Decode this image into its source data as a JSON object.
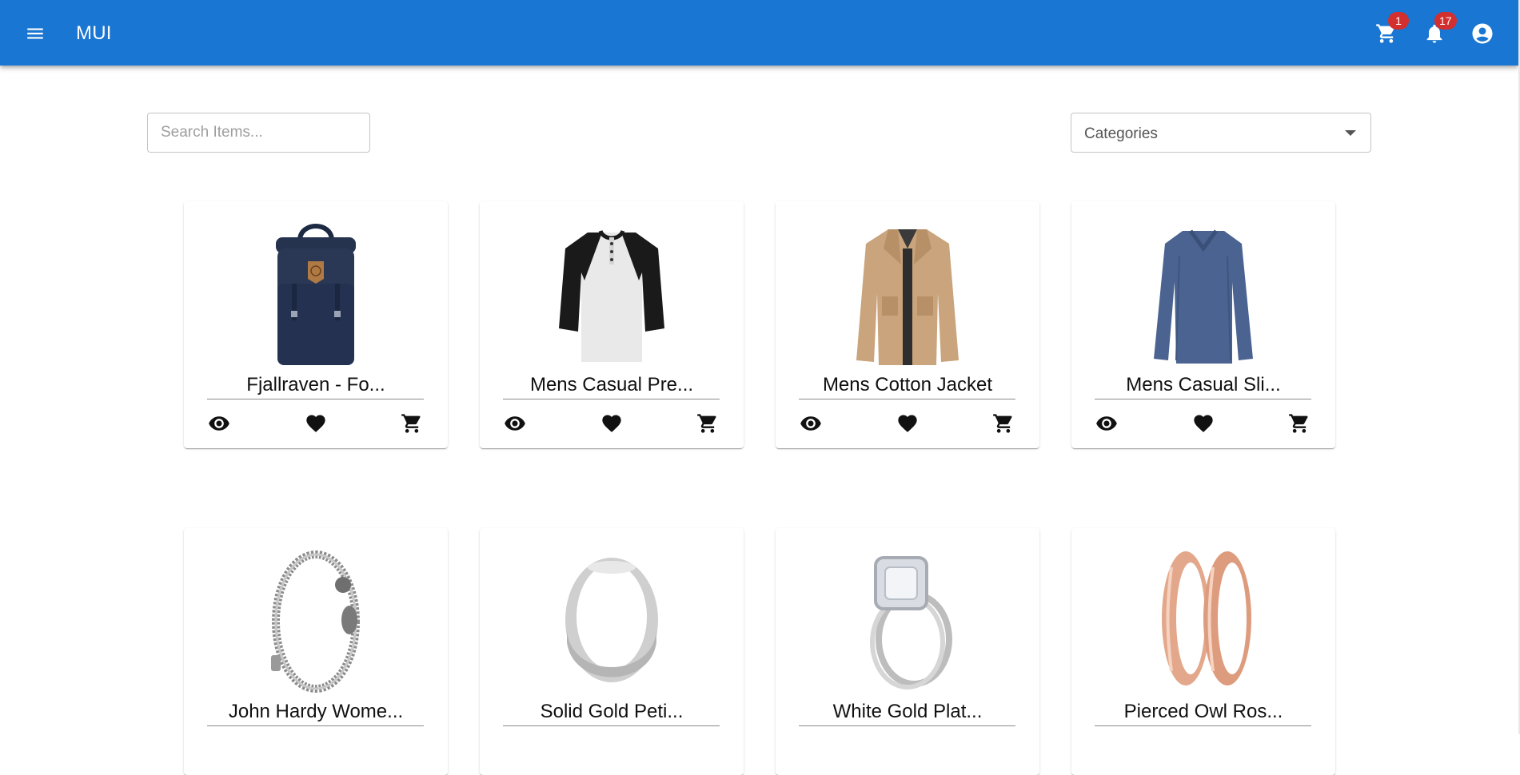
{
  "appbar": {
    "brand": "MUI",
    "cart_badge": "1",
    "notifications_badge": "17"
  },
  "search": {
    "placeholder": "Search Items..."
  },
  "categories": {
    "value": "Categories"
  },
  "products": [
    {
      "title": "Fjallraven - Fo...",
      "image": "backpack"
    },
    {
      "title": "Mens Casual Pre...",
      "image": "raglan-tee"
    },
    {
      "title": "Mens Cotton Jacket",
      "image": "khaki-jacket"
    },
    {
      "title": "Mens Casual Sli...",
      "image": "blue-longsleeve"
    },
    {
      "title": "John Hardy Wome...",
      "image": "chain-bracelet"
    },
    {
      "title": "Solid Gold Peti...",
      "image": "silver-ring"
    },
    {
      "title": "White Gold Plat...",
      "image": "diamond-ring"
    },
    {
      "title": "Pierced Owl Ros...",
      "image": "rose-gold-plugs"
    }
  ],
  "actions": [
    "view-icon",
    "favorite-icon",
    "add-to-cart-icon"
  ]
}
